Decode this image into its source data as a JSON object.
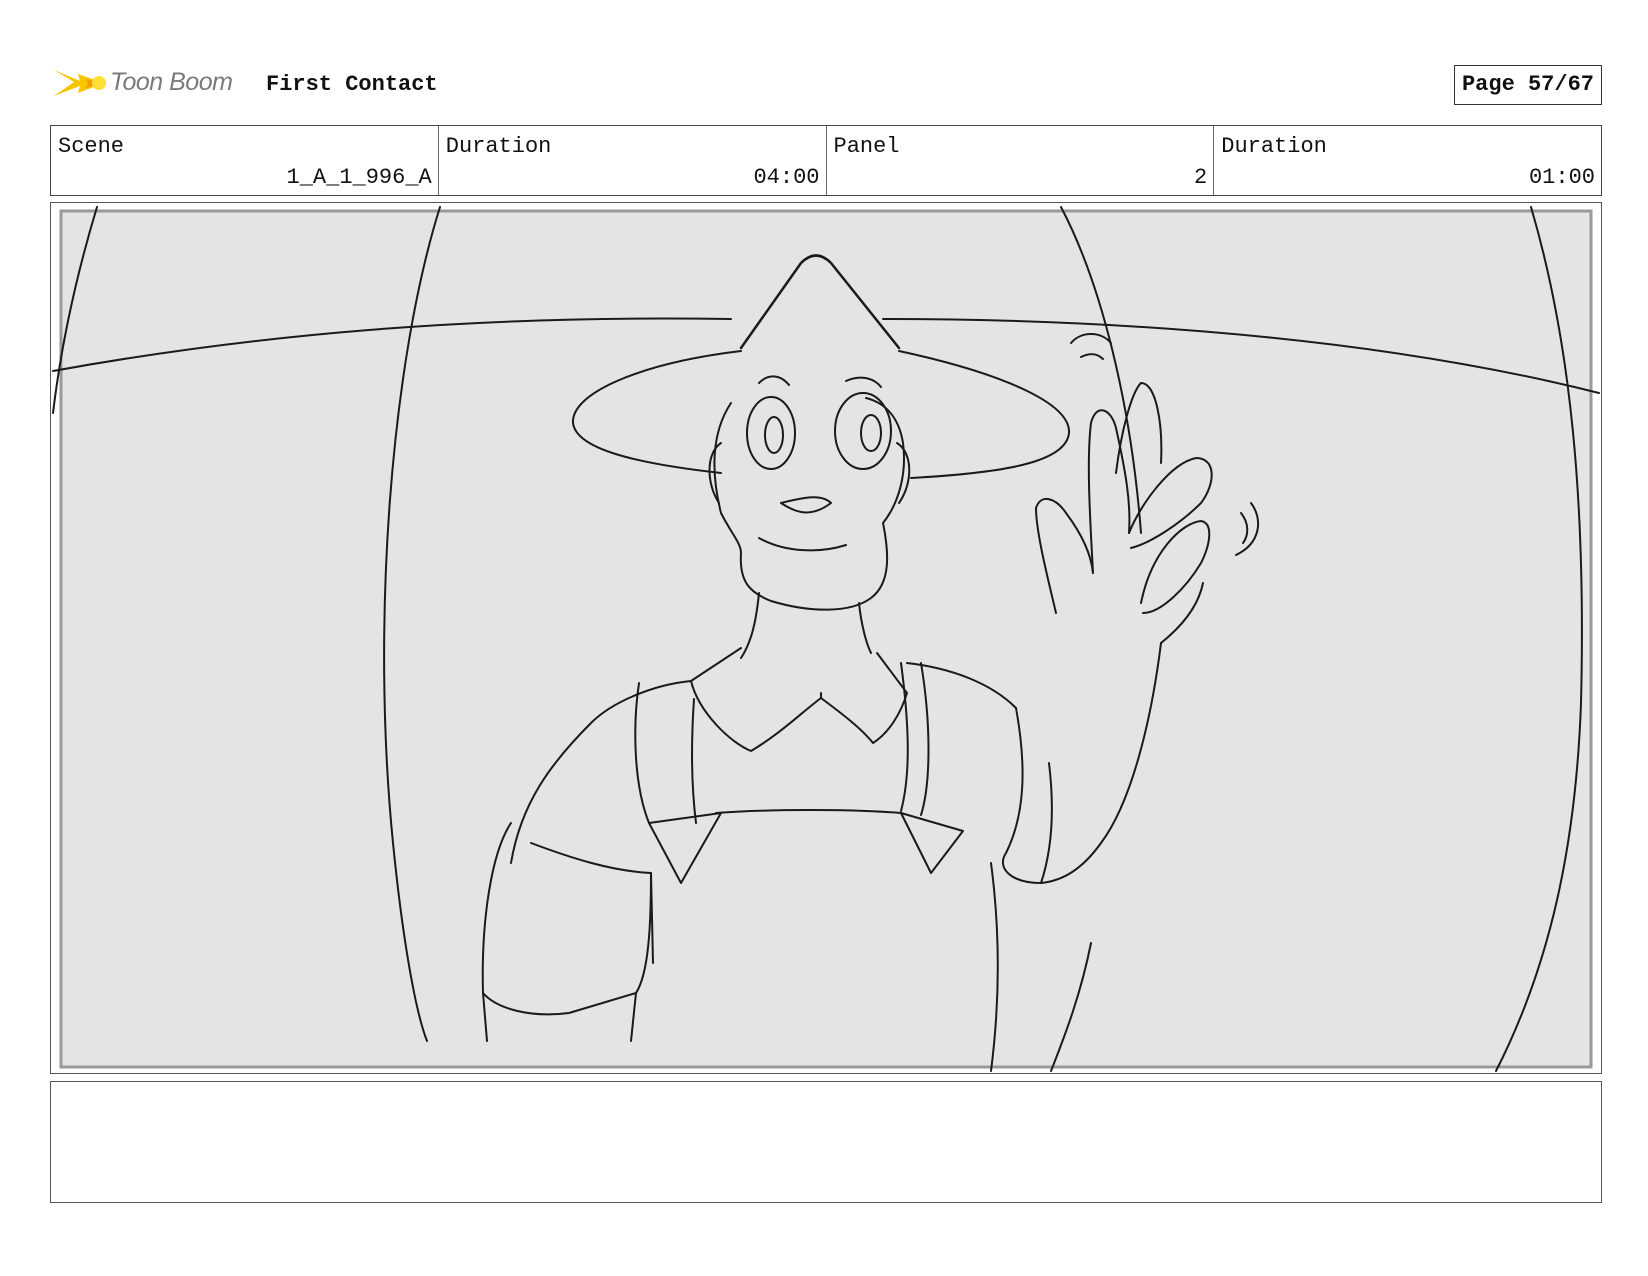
{
  "header": {
    "logo_text": "Toon Boom",
    "project_title": "First Contact",
    "page_label": "Page 57/67"
  },
  "info": {
    "scene": {
      "label": "Scene",
      "value": "1_A_1_996_A"
    },
    "scene_duration": {
      "label": "Duration",
      "value": "04:00"
    },
    "panel": {
      "label": "Panel",
      "value": "2"
    },
    "panel_duration": {
      "label": "Duration",
      "value": "01:00"
    }
  },
  "panel": {
    "image_icon": "storyboard-sketch-farmer-waving",
    "background_color": "#e4e4e4"
  },
  "notes": {
    "text": ""
  }
}
